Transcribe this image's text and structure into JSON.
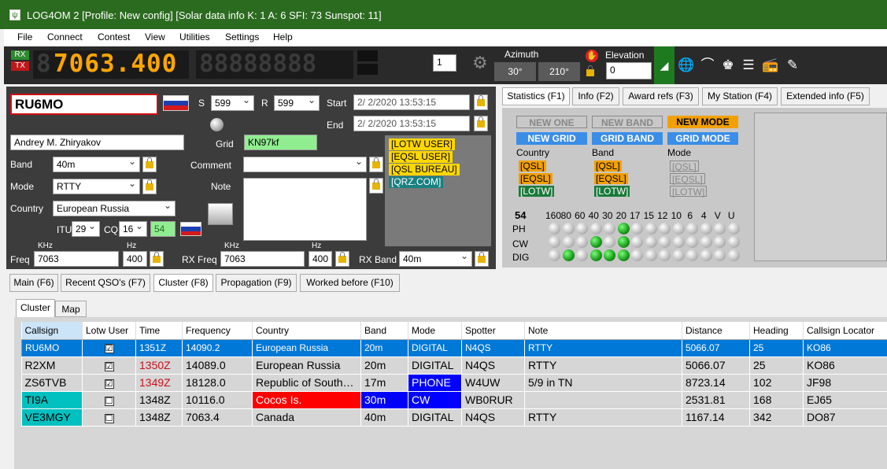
{
  "window": {
    "title": "LOG4OM 2 [Profile: New config] [Solar data info K: 1 A: 6 SFI: 73 Sunspot: 11]"
  },
  "menu": [
    "File",
    "Connect",
    "Contest",
    "View",
    "Utilities",
    "Settings",
    "Help"
  ],
  "toolbar": {
    "rx": "RX",
    "tx": "TX",
    "freq_display": "7063.400",
    "vfo_value": "1",
    "azimuth_label": "Azimuth",
    "az1": "30°",
    "az2": "210°",
    "elevation_label": "Elevation",
    "elevation_value": "0"
  },
  "qso": {
    "callsign": "RU6MO",
    "s_label": "S",
    "s_value": "599",
    "r_label": "R",
    "r_value": "599",
    "start_label": "Start",
    "start_value": "2/  2/2020 13:53:15",
    "end_label": "End",
    "end_value": "2/  2/2020 13:53:15",
    "name": "Andrey M. Zhiryakov",
    "grid_label": "Grid",
    "grid_value": "KN97kf",
    "band_label": "Band",
    "band_value": "40m",
    "mode_label": "Mode",
    "mode_value": "RTTY",
    "country_label": "Country",
    "country_value": "European Russia",
    "comment_label": "Comment",
    "note_label": "Note",
    "itu_label": "ITU",
    "itu_value": "29",
    "cq_label": "CQ",
    "cq_value": "16",
    "dxcc_value": "54",
    "khz_label": "KHz",
    "hz_label": "Hz",
    "freq_label": "Freq",
    "freq_value": "7063",
    "freq_hz": "400",
    "rxfreq_label": "RX Freq",
    "rxfreq_value": "7063",
    "rxfreq_hz": "400",
    "rxband_label": "RX Band",
    "rxband_value": "40m",
    "tags": [
      "[LOTW USER]",
      "[EQSL USER]",
      "[QSL BUREAU]",
      "[QRZ.COM]"
    ]
  },
  "stat_tabs": [
    "Statistics (F1)",
    "Info (F2)",
    "Award refs (F3)",
    "My Station (F4)",
    "Extended info (F5)"
  ],
  "stats": {
    "new_one": "NEW ONE",
    "new_band": "NEW BAND",
    "new_mode": "NEW MODE",
    "new_grid": "NEW GRID",
    "grid_band": "GRID BAND",
    "grid_mode": "GRID MODE",
    "col_country": "Country",
    "col_band": "Band",
    "col_mode": "Mode",
    "qsl": "[QSL]",
    "eqsl": "[EQSL]",
    "lotw": "[LOTW]",
    "dxcc": "54",
    "bands": [
      "160",
      "80",
      "60",
      "40",
      "30",
      "20",
      "17",
      "15",
      "12",
      "10",
      "6",
      "4",
      "V",
      "U"
    ],
    "rows": [
      "PH",
      "CW",
      "DIG"
    ]
  },
  "main_tabs": [
    "Main (F6)",
    "Recent QSO's (F7)",
    "Cluster (F8)",
    "Propagation (F9)",
    "Worked before (F10)"
  ],
  "sub_tabs": [
    "Cluster",
    "Map"
  ],
  "cluster": {
    "headers": [
      "Callsign",
      "Lotw User",
      "Time",
      "Frequency",
      "Country",
      "Band",
      "Mode",
      "Spotter",
      "Note",
      "Distance",
      "Heading",
      "Callsign Locator"
    ],
    "rows": [
      {
        "call": "RU6MO",
        "lotw": "☑",
        "time": "1351Z",
        "freq": "14090.2",
        "country": "European Russia",
        "band": "20m",
        "mode": "DIGITAL",
        "spotter": "N4QS",
        "note": "RTTY",
        "dist": "5066.07",
        "head": "25",
        "loc": "KO86"
      },
      {
        "call": "R2XM",
        "lotw": "☑",
        "time": "1350Z",
        "freq": "14089.0",
        "country": "European Russia",
        "band": "20m",
        "mode": "DIGITAL",
        "spotter": "N4QS",
        "note": "RTTY",
        "dist": "5066.07",
        "head": "25",
        "loc": "KO86"
      },
      {
        "call": "ZS6TVB",
        "lotw": "☑",
        "time": "1349Z",
        "freq": "18128.0",
        "country": "Republic of South…",
        "band": "17m",
        "mode": "PHONE",
        "spotter": "W4UW",
        "note": "5/9 in TN",
        "dist": "8723.14",
        "head": "102",
        "loc": "JF98"
      },
      {
        "call": "TI9A",
        "lotw": "☐",
        "time": "1348Z",
        "freq": "10116.0",
        "country": "Cocos Is.",
        "band": "30m",
        "mode": "CW",
        "spotter": "WB0RUR",
        "note": "",
        "dist": "2531.81",
        "head": "168",
        "loc": "EJ65"
      },
      {
        "call": "VE3MGY",
        "lotw": "☐",
        "time": "1348Z",
        "freq": "7063.4",
        "country": "Canada",
        "band": "40m",
        "mode": "DIGITAL",
        "spotter": "N4QS",
        "note": "RTTY",
        "dist": "1167.14",
        "head": "342",
        "loc": "DO87"
      }
    ]
  },
  "colors": {
    "titlebar": "#2b6b1f",
    "accent": "#0078d7",
    "lcd": "#ffa500"
  }
}
